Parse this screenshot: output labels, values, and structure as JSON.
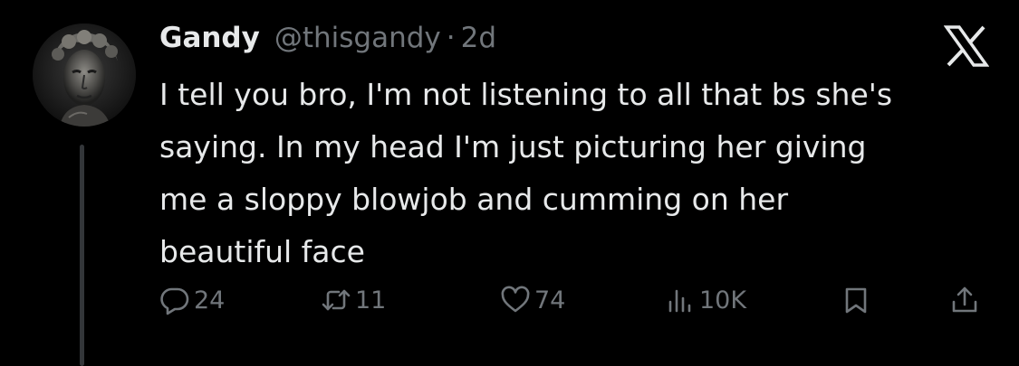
{
  "tweet": {
    "author_name": "Gandy",
    "handle": "@thisgandy",
    "separator": "·",
    "time": "2d",
    "body_lines": [
      "I tell you bro, I'm not listening to all that bs she's",
      "saying. In my head I'm just picturing her giving",
      "me a sloppy blowjob and cumming on her",
      "beautiful face"
    ]
  },
  "actions": {
    "reply_count": "24",
    "retweet_count": "11",
    "like_count": "74",
    "views_count": "10K"
  },
  "icons": {
    "brand": "x-logo-icon",
    "reply": "reply-icon",
    "retweet": "retweet-icon",
    "like": "heart-icon",
    "views": "views-chart-icon",
    "bookmark": "bookmark-icon",
    "share": "share-icon"
  },
  "colors": {
    "background": "#000000",
    "primary_text": "#e7e9ea",
    "secondary_text": "#71767b",
    "thread_line": "#333639"
  }
}
